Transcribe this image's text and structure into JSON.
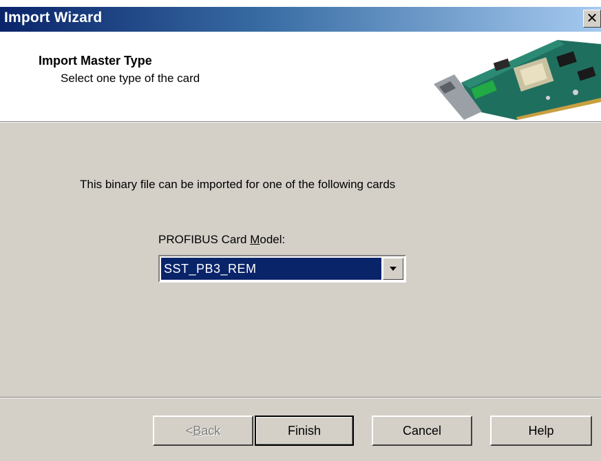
{
  "window": {
    "title": "Import Wizard",
    "close_glyph": "✕"
  },
  "header": {
    "title": "Import Master Type",
    "subtitle": "Select one type of the card",
    "image_icon": "pci-card-image"
  },
  "main": {
    "description": "This binary file can be imported for one of the following cards",
    "field_label_pre": "PROFIBUS Card ",
    "field_label_accel": "M",
    "field_label_post": "odel:",
    "selected_card_model": "SST_PB3_REM"
  },
  "buttons": {
    "back_pre": "< ",
    "back_accel": "B",
    "back_post": "ack",
    "finish": "Finish",
    "cancel": "Cancel",
    "help": "Help"
  },
  "colors": {
    "titlebar_start": "#0a246a",
    "titlebar_end": "#a6caf0",
    "dialog_face": "#d4d0c8",
    "selection": "#0a246a"
  }
}
